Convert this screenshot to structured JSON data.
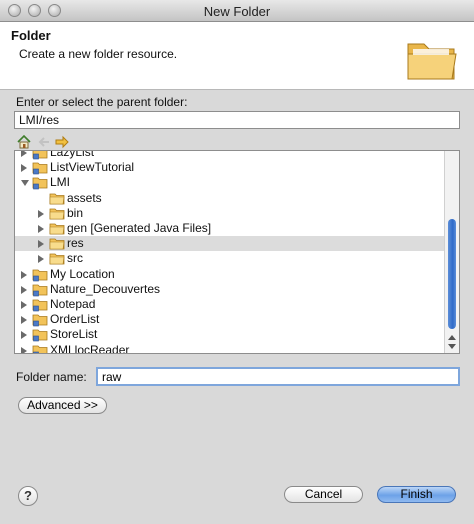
{
  "window": {
    "title": "New Folder"
  },
  "header": {
    "title": "Folder",
    "message": "Create a new folder resource."
  },
  "parent": {
    "label": "Enter or select the parent folder:",
    "value": "LMI/res"
  },
  "tree": {
    "items": [
      {
        "label": "LazyList",
        "depth": 0,
        "expander": "closed",
        "icon": "project",
        "selected": false
      },
      {
        "label": "ListViewTutorial",
        "depth": 0,
        "expander": "closed",
        "icon": "project",
        "selected": false
      },
      {
        "label": "LMI",
        "depth": 0,
        "expander": "open",
        "icon": "project",
        "selected": false
      },
      {
        "label": "assets",
        "depth": 1,
        "expander": "none",
        "icon": "folder",
        "selected": false
      },
      {
        "label": "bin",
        "depth": 1,
        "expander": "closed",
        "icon": "folder",
        "selected": false
      },
      {
        "label": "gen [Generated Java Files]",
        "depth": 1,
        "expander": "closed",
        "icon": "folder",
        "selected": false
      },
      {
        "label": "res",
        "depth": 1,
        "expander": "closed",
        "icon": "folder",
        "selected": true
      },
      {
        "label": "src",
        "depth": 1,
        "expander": "closed",
        "icon": "folder",
        "selected": false
      },
      {
        "label": "My Location",
        "depth": 0,
        "expander": "closed",
        "icon": "project",
        "selected": false
      },
      {
        "label": "Nature_Decouvertes",
        "depth": 0,
        "expander": "closed",
        "icon": "project",
        "selected": false
      },
      {
        "label": "Notepad",
        "depth": 0,
        "expander": "closed",
        "icon": "project",
        "selected": false
      },
      {
        "label": "OrderList",
        "depth": 0,
        "expander": "closed",
        "icon": "project",
        "selected": false
      },
      {
        "label": "StoreList",
        "depth": 0,
        "expander": "closed",
        "icon": "project",
        "selected": false
      },
      {
        "label": "XMLlocReader",
        "depth": 0,
        "expander": "closed",
        "icon": "project",
        "selected": false
      }
    ]
  },
  "folder_name": {
    "label": "Folder name:",
    "value": "raw"
  },
  "buttons": {
    "advanced": "Advanced >>",
    "cancel": "Cancel",
    "finish": "Finish",
    "help": "?"
  },
  "colors": {
    "accent": "#6da2e8",
    "selection": "#dcdcdc",
    "folder": "#f2c35a"
  }
}
